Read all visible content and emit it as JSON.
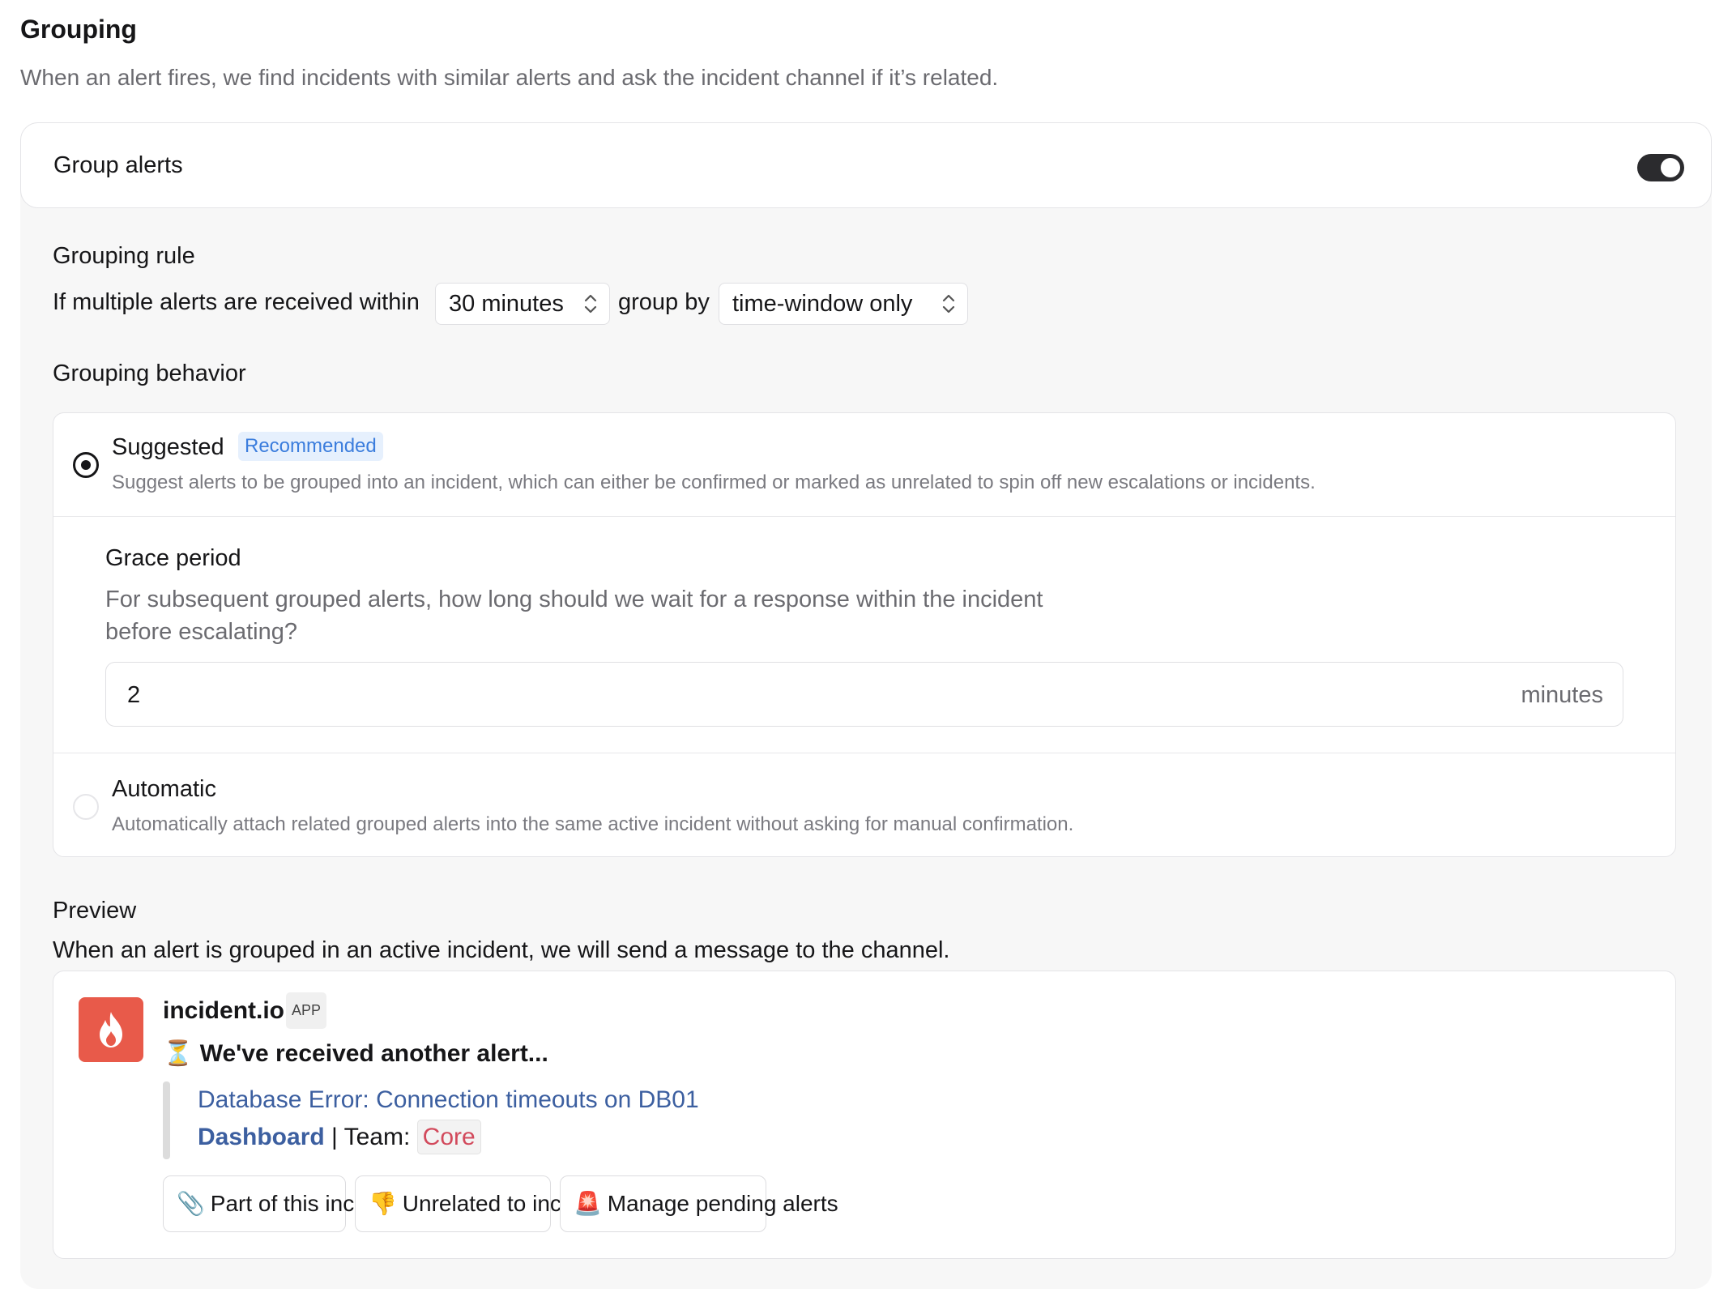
{
  "header": {
    "title": "Grouping",
    "description": "When an alert fires, we find incidents with similar alerts and ask the incident channel if it’s related."
  },
  "group_alerts": {
    "label": "Group alerts",
    "enabled": true
  },
  "grouping_rule": {
    "title": "Grouping rule",
    "prefix": "If multiple alerts are received within",
    "time_window": "30 minutes",
    "middle": "group by",
    "group_by": "time-window only"
  },
  "grouping_behavior": {
    "title": "Grouping behavior",
    "suggested": {
      "title": "Suggested",
      "badge": "Recommended",
      "description": "Suggest alerts to be grouped into an incident, which can either be confirmed or marked as unrelated to spin off new escalations or incidents.",
      "selected": true
    },
    "grace_period": {
      "title": "Grace period",
      "description": "For subsequent grouped alerts, how long should we wait for a response within the incident before escalating?",
      "value": "2",
      "unit": "minutes"
    },
    "automatic": {
      "title": "Automatic",
      "description": "Automatically attach related grouped alerts into the same active incident without asking for manual confirmation.",
      "selected": false
    }
  },
  "preview": {
    "title": "Preview",
    "description": "When an alert is grouped in an active incident, we will send a message to the channel.",
    "message": {
      "app_name": "incident.io",
      "app_tag": "APP",
      "headline_icon": "⏳",
      "headline": "We've received another alert...",
      "alert_link": "Database Error: Connection timeouts on DB01",
      "dashboard_label": "Dashboard",
      "team_prefix": " | Team: ",
      "team": "Core",
      "actions": [
        {
          "icon": "📎",
          "label": "Part of this incident"
        },
        {
          "icon": "👎",
          "label": "Unrelated to incident"
        },
        {
          "icon": "🚨",
          "label": "Manage pending alerts"
        }
      ]
    }
  },
  "colors": {
    "brand_logo": "#e85a4a",
    "link": "#3c5fa0",
    "badge_bg": "#e6f0fd",
    "badge_text": "#3b7ddd",
    "team_text": "#d24a5c"
  }
}
